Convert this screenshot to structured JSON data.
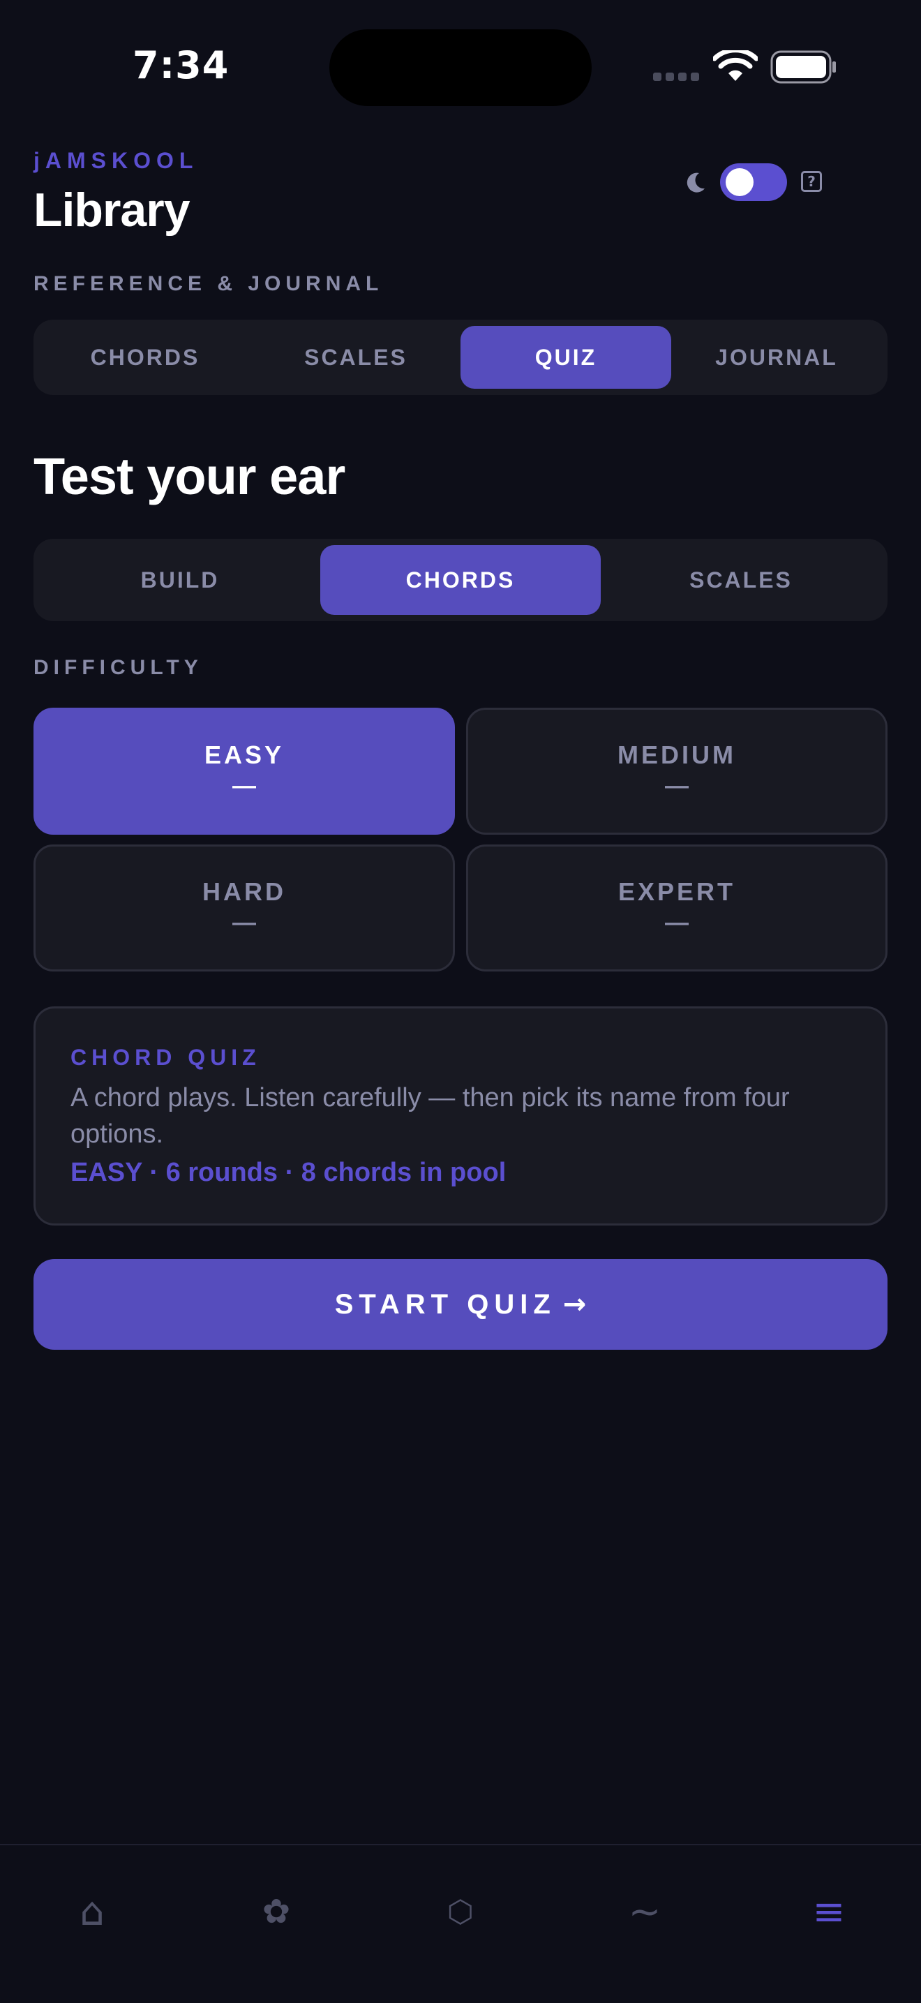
{
  "status_bar": {
    "time": "7:34"
  },
  "header": {
    "brand": "jAMSKOOL",
    "title": "Library",
    "theme_toggle_on": true
  },
  "section_label": "REFERENCE & JOURNAL",
  "main_tabs": [
    {
      "label": "CHORDS",
      "active": false
    },
    {
      "label": "SCALES",
      "active": false
    },
    {
      "label": "QUIZ",
      "active": true
    },
    {
      "label": "JOURNAL",
      "active": false
    }
  ],
  "quiz": {
    "title": "Test your ear",
    "mode_tabs": [
      {
        "label": "BUILD",
        "active": false
      },
      {
        "label": "CHORDS",
        "active": true
      },
      {
        "label": "SCALES",
        "active": false
      }
    ],
    "difficulty_label": "DIFFICULTY",
    "difficulties": [
      {
        "label": "EASY",
        "score": "—",
        "active": true
      },
      {
        "label": "MEDIUM",
        "score": "—",
        "active": false
      },
      {
        "label": "HARD",
        "score": "—",
        "active": false
      },
      {
        "label": "EXPERT",
        "score": "—",
        "active": false
      }
    ],
    "info": {
      "kicker": "CHORD QUIZ",
      "description": "A chord plays. Listen carefully — then pick its name from four options.",
      "meta": "EASY · 6 rounds · 8 chords in pool"
    },
    "start_label": "START QUIZ",
    "start_arrow": "→"
  },
  "bottom_nav": [
    {
      "icon": "home-icon",
      "glyph": "⌂",
      "active": false
    },
    {
      "icon": "flower-icon",
      "glyph": "✿",
      "active": false
    },
    {
      "icon": "hexagon-icon",
      "glyph": "⬡",
      "active": false
    },
    {
      "icon": "wave-icon",
      "glyph": "∼",
      "active": false
    },
    {
      "icon": "menu-icon",
      "glyph": "≡",
      "active": true
    }
  ],
  "colors": {
    "background": "#0d0e18",
    "accent": "#564dbd",
    "accent_text": "#5b4fd0",
    "muted_text": "#8a8ca8",
    "card": "#181922"
  }
}
